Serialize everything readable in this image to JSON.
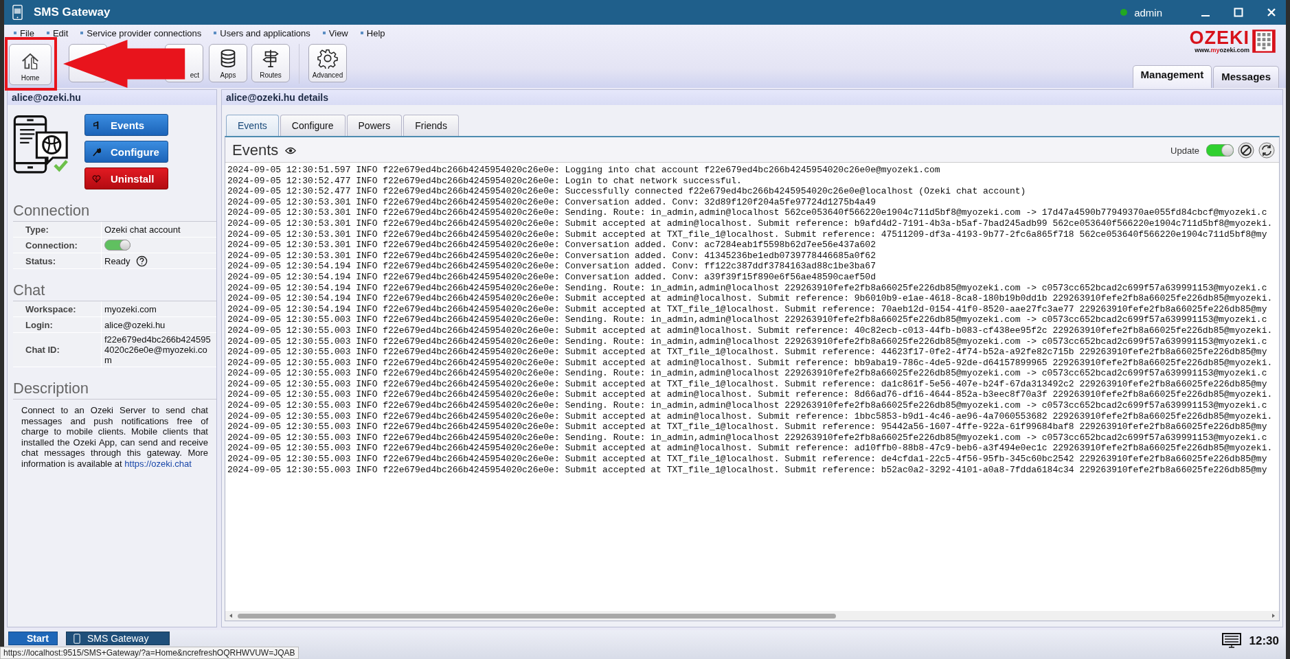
{
  "window": {
    "title": "SMS Gateway",
    "user": "admin",
    "user_online": true
  },
  "menu": [
    "File",
    "Edit",
    "Service provider connections",
    "Users and applications",
    "View",
    "Help"
  ],
  "toolbar": [
    {
      "kind": "home",
      "label": "Home"
    },
    {
      "kind": "covered"
    },
    {
      "kind": "connect",
      "label": "ect"
    },
    {
      "kind": "apps",
      "label": "Apps"
    },
    {
      "kind": "routes",
      "label": "Routes"
    },
    {
      "kind": "advanced",
      "label": "Advanced"
    }
  ],
  "logo": {
    "name": "OZEKI",
    "url_prefix": "www.",
    "url_mark": "my",
    "url_suffix": "ozeki.com"
  },
  "view_tabs": [
    {
      "label": "Management",
      "selected": true
    },
    {
      "label": "Messages",
      "selected": false
    }
  ],
  "sidebar": {
    "title": "alice@ozeki.hu",
    "actions": [
      {
        "kind": "events",
        "label": "Events"
      },
      {
        "kind": "configure",
        "label": "Configure"
      },
      {
        "kind": "uninstall",
        "label": "Uninstall"
      }
    ],
    "sections": [
      {
        "title": "Connection",
        "rows": [
          {
            "label": "Type:",
            "value": "Ozeki chat account"
          },
          {
            "label": "Connection:",
            "kind": "toggle",
            "on": true
          },
          {
            "label": "Status:",
            "value": "Ready",
            "help": true
          }
        ]
      },
      {
        "title": "Chat",
        "rows": [
          {
            "label": "Workspace:",
            "value": "myozeki.com"
          },
          {
            "label": "Login:",
            "value": "alice@ozeki.hu"
          },
          {
            "label": "Chat ID:",
            "value": "f22e679ed4bc266b4245954020c26e0e@myozeki.com"
          }
        ]
      }
    ],
    "description": {
      "title": "Description",
      "text": "Connect to an Ozeki Server to send chat messages and push notifications free of charge to mobile clients. Mobile clients that installed the Ozeki App, can send and receive chat messages through this gateway. More information is available at",
      "link": "https://ozeki.chat"
    }
  },
  "details": {
    "title": "alice@ozeki.hu details",
    "tabs": [
      {
        "label": "Events",
        "selected": true
      },
      {
        "label": "Configure",
        "selected": false
      },
      {
        "label": "Powers",
        "selected": false
      },
      {
        "label": "Friends",
        "selected": false
      }
    ],
    "events": {
      "title": "Events",
      "update_label": "Update",
      "update_on": true,
      "log": [
        "2024-09-05 12:30:51.597 INFO f22e679ed4bc266b4245954020c26e0e: Logging into chat account f22e679ed4bc266b4245954020c26e0e@myozeki.com",
        "2024-09-05 12:30:52.477 INFO f22e679ed4bc266b4245954020c26e0e: Login to chat network successful.",
        "2024-09-05 12:30:52.477 INFO f22e679ed4bc266b4245954020c26e0e: Successfully connected f22e679ed4bc266b4245954020c26e0e@localhost (Ozeki chat account)",
        "2024-09-05 12:30:53.301 INFO f22e679ed4bc266b4245954020c26e0e: Conversation added. Conv: 32d89f120f204a5fe97724d1275b4a49",
        "2024-09-05 12:30:53.301 INFO f22e679ed4bc266b4245954020c26e0e: Sending. Route: in_admin,admin@localhost 562ce053640f566220e1904c711d5bf8@myozeki.com -> 17d47a4590b77949370ae055fd84cbcf@myozeki.c",
        "2024-09-05 12:30:53.301 INFO f22e679ed4bc266b4245954020c26e0e: Submit accepted at admin@localhost. Submit reference: b9afd4d2-7191-4b3a-b5af-7bad245adb99 562ce053640f566220e1904c711d5bf8@myozeki.",
        "2024-09-05 12:30:53.301 INFO f22e679ed4bc266b4245954020c26e0e: Submit accepted at TXT_file_1@localhost. Submit reference: 47511209-df3a-4193-9b77-2fc6a865f718 562ce053640f566220e1904c711d5bf8@my",
        "2024-09-05 12:30:53.301 INFO f22e679ed4bc266b4245954020c26e0e: Conversation added. Conv: ac7284eab1f5598b62d7ee56e437a602",
        "2024-09-05 12:30:53.301 INFO f22e679ed4bc266b4245954020c26e0e: Conversation added. Conv: 41345236be1edb0739778446685a0f62",
        "2024-09-05 12:30:54.194 INFO f22e679ed4bc266b4245954020c26e0e: Conversation added. Conv: ff122c387ddf3784163ad88c1be3ba67",
        "2024-09-05 12:30:54.194 INFO f22e679ed4bc266b4245954020c26e0e: Conversation added. Conv: a39f39f15f890e6f56ae48590caef50d",
        "2024-09-05 12:30:54.194 INFO f22e679ed4bc266b4245954020c26e0e: Sending. Route: in_admin,admin@localhost 229263910fefe2fb8a66025fe226db85@myozeki.com -> c0573cc652bcad2c699f57a639991153@myozeki.c",
        "2024-09-05 12:30:54.194 INFO f22e679ed4bc266b4245954020c26e0e: Submit accepted at admin@localhost. Submit reference: 9b6010b9-e1ae-4618-8ca8-180b19b0dd1b 229263910fefe2fb8a66025fe226db85@myozeki.",
        "2024-09-05 12:30:54.194 INFO f22e679ed4bc266b4245954020c26e0e: Submit accepted at TXT_file_1@localhost. Submit reference: 70aeb12d-0154-41f0-8520-aae27fc3ae77 229263910fefe2fb8a66025fe226db85@my",
        "2024-09-05 12:30:55.003 INFO f22e679ed4bc266b4245954020c26e0e: Sending. Route: in_admin,admin@localhost 229263910fefe2fb8a66025fe226db85@myozeki.com -> c0573cc652bcad2c699f57a639991153@myozeki.c",
        "2024-09-05 12:30:55.003 INFO f22e679ed4bc266b4245954020c26e0e: Submit accepted at admin@localhost. Submit reference: 40c82ecb-c013-44fb-b083-cf438ee95f2c 229263910fefe2fb8a66025fe226db85@myozeki.",
        "2024-09-05 12:30:55.003 INFO f22e679ed4bc266b4245954020c26e0e: Sending. Route: in_admin,admin@localhost 229263910fefe2fb8a66025fe226db85@myozeki.com -> c0573cc652bcad2c699f57a639991153@myozeki.c",
        "2024-09-05 12:30:55.003 INFO f22e679ed4bc266b4245954020c26e0e: Submit accepted at TXT_file_1@localhost. Submit reference: 44623f17-0fe2-4f74-b52a-a92fe82c715b 229263910fefe2fb8a66025fe226db85@my",
        "2024-09-05 12:30:55.003 INFO f22e679ed4bc266b4245954020c26e0e: Submit accepted at admin@localhost. Submit reference: bb9aba19-786c-4de5-92de-d64157899965 229263910fefe2fb8a66025fe226db85@myozeki.",
        "2024-09-05 12:30:55.003 INFO f22e679ed4bc266b4245954020c26e0e: Sending. Route: in_admin,admin@localhost 229263910fefe2fb8a66025fe226db85@myozeki.com -> c0573cc652bcad2c699f57a639991153@myozeki.c",
        "2024-09-05 12:30:55.003 INFO f22e679ed4bc266b4245954020c26e0e: Submit accepted at TXT_file_1@localhost. Submit reference: da1c861f-5e56-407e-b24f-67da313492c2 229263910fefe2fb8a66025fe226db85@my",
        "2024-09-05 12:30:55.003 INFO f22e679ed4bc266b4245954020c26e0e: Submit accepted at admin@localhost. Submit reference: 8d66ad76-df16-4644-852a-b3eec8f70a3f 229263910fefe2fb8a66025fe226db85@myozeki.",
        "2024-09-05 12:30:55.003 INFO f22e679ed4bc266b4245954020c26e0e: Sending. Route: in_admin,admin@localhost 229263910fefe2fb8a66025fe226db85@myozeki.com -> c0573cc652bcad2c699f57a639991153@myozeki.c",
        "2024-09-05 12:30:55.003 INFO f22e679ed4bc266b4245954020c26e0e: Submit accepted at admin@localhost. Submit reference: 1bbc5853-b9d1-4c46-ae96-4a7060553682 229263910fefe2fb8a66025fe226db85@myozeki.",
        "2024-09-05 12:30:55.003 INFO f22e679ed4bc266b4245954020c26e0e: Submit accepted at TXT_file_1@localhost. Submit reference: 95442a56-1607-4ffe-922a-61f99684baf8 229263910fefe2fb8a66025fe226db85@my",
        "2024-09-05 12:30:55.003 INFO f22e679ed4bc266b4245954020c26e0e: Sending. Route: in_admin,admin@localhost 229263910fefe2fb8a66025fe226db85@myozeki.com -> c0573cc652bcad2c699f57a639991153@myozeki.c",
        "2024-09-05 12:30:55.003 INFO f22e679ed4bc266b4245954020c26e0e: Submit accepted at admin@localhost. Submit reference: ad10ffb0-88b8-47c9-beb6-a3f494e0ec1c 229263910fefe2fb8a66025fe226db85@myozeki.",
        "2024-09-05 12:30:55.003 INFO f22e679ed4bc266b4245954020c26e0e: Submit accepted at TXT_file_1@localhost. Submit reference: de4cfda1-22c5-4f56-95fb-345c60bc2542 229263910fefe2fb8a66025fe226db85@my",
        "2024-09-05 12:30:55.003 INFO f22e679ed4bc266b4245954020c26e0e: Submit accepted at TXT_file_1@localhost. Submit reference: b52ac0a2-3292-4101-a0a8-7fdda6184c34 229263910fefe2fb8a66025fe226db85@my"
      ]
    }
  },
  "taskbar": {
    "start": "Start",
    "apps": [
      {
        "label": "SMS Gateway"
      }
    ],
    "clock": "12:30"
  },
  "status_url": "https://localhost:9515/SMS+Gateway/?a=Home&ncrefreshOQRHWVUW=JQAB"
}
